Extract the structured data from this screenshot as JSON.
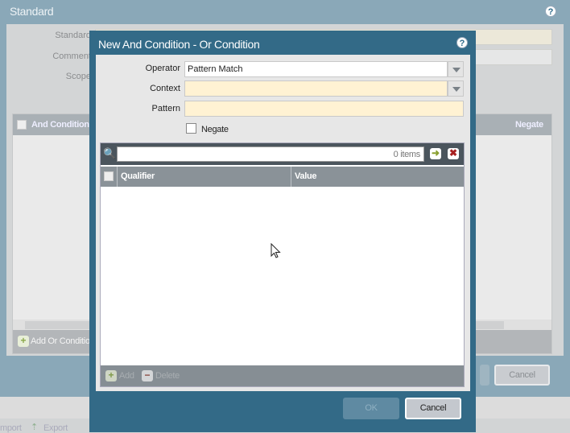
{
  "background_dialog": {
    "title": "Standard",
    "fields": [
      {
        "label": "Standard"
      },
      {
        "label": "Comment"
      },
      {
        "label": "Scope"
      }
    ],
    "table": {
      "columns": [
        "And Condition",
        "Negate"
      ],
      "add_label": "Add Or Condition"
    },
    "cancel_label": "Cancel"
  },
  "bottom_bar": {
    "import_label": "mport",
    "export_label": "Export"
  },
  "modal": {
    "title": "New And Condition - Or Condition",
    "operator": {
      "label": "Operator",
      "value": "Pattern Match"
    },
    "context": {
      "label": "Context",
      "value": ""
    },
    "pattern": {
      "label": "Pattern",
      "value": ""
    },
    "negate": {
      "label": "Negate",
      "checked": false
    },
    "grid": {
      "search_value": "",
      "count": "0 items",
      "columns": [
        "Qualifier",
        "Value"
      ],
      "rows": [],
      "add_label": "Add",
      "delete_label": "Delete"
    },
    "ok_label": "OK",
    "cancel_label": "Cancel"
  },
  "colors": {
    "modal_frame": "#336a87",
    "required_field": "#fff2d3",
    "grid_toolbar": "#4b555d"
  }
}
